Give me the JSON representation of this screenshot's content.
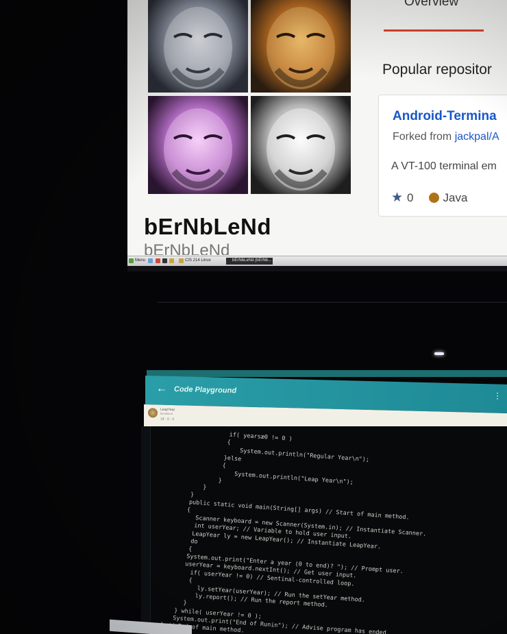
{
  "github": {
    "tab_overview": "Overview",
    "display_name": "bErNbLeNd",
    "username": "bErNbLeNd",
    "popular_heading": "Popular repositor",
    "repo": {
      "name": "Android-Termina",
      "forked_prefix": "Forked from ",
      "forked_link": "jackpal/A",
      "description": "A VT-100 terminal em",
      "stars": "0",
      "language": "Java"
    }
  },
  "taskbar": {
    "menu_label": "Menu",
    "folder_label": "CIS 214 Linux",
    "active_task": "bErNbLeNd (bErNb..."
  },
  "colors": {
    "accent_red": "#d9432f",
    "link_blue": "#1757c8",
    "java_orange": "#b07219",
    "app_bar_teal": "#2a9ea8"
  },
  "app": {
    "title": "Code Playground",
    "file_name": "LeapYear",
    "file_author": "bernblend",
    "file_stats": "18 · 0 · 0"
  },
  "code_lines": [
    "          if( yearsæ0 != 0 )",
    "          {",
    "              System.out.println(\"Regular Year\\n\");",
    "          }else",
    "          {",
    "              System.out.println(\"Leap Year\\n\");",
    "          }",
    "      }",
    "   }",
    "   public static void main(String[] args) // Start of main method.",
    "   {",
    "      Scanner keyboard = new Scanner(System.in); // Instantiate Scanner.",
    "      int userYear; // Variable to hold user input.",
    "      LeapYear ly = new LeapYear(); // Instantiate LeapYear.",
    "      do",
    "      {",
    "      System.out.print(\"Enter a year (0 to end)? \"); // Prompt user.",
    "      userYear = keyboard.nextInt(); // Get user input.",
    "        if( userYear != 0) // Sentinal-controlled loop.",
    "        {",
    "           ly.setYear(userYear); // Run the setYear method.",
    "           ly.report(); // Run the report method.",
    "        }",
    "      } while( userYear != 0 );",
    "      System.out.print(\"End of Runin\"); // Advise program has ended.",
    "   } // End of main method."
  ]
}
